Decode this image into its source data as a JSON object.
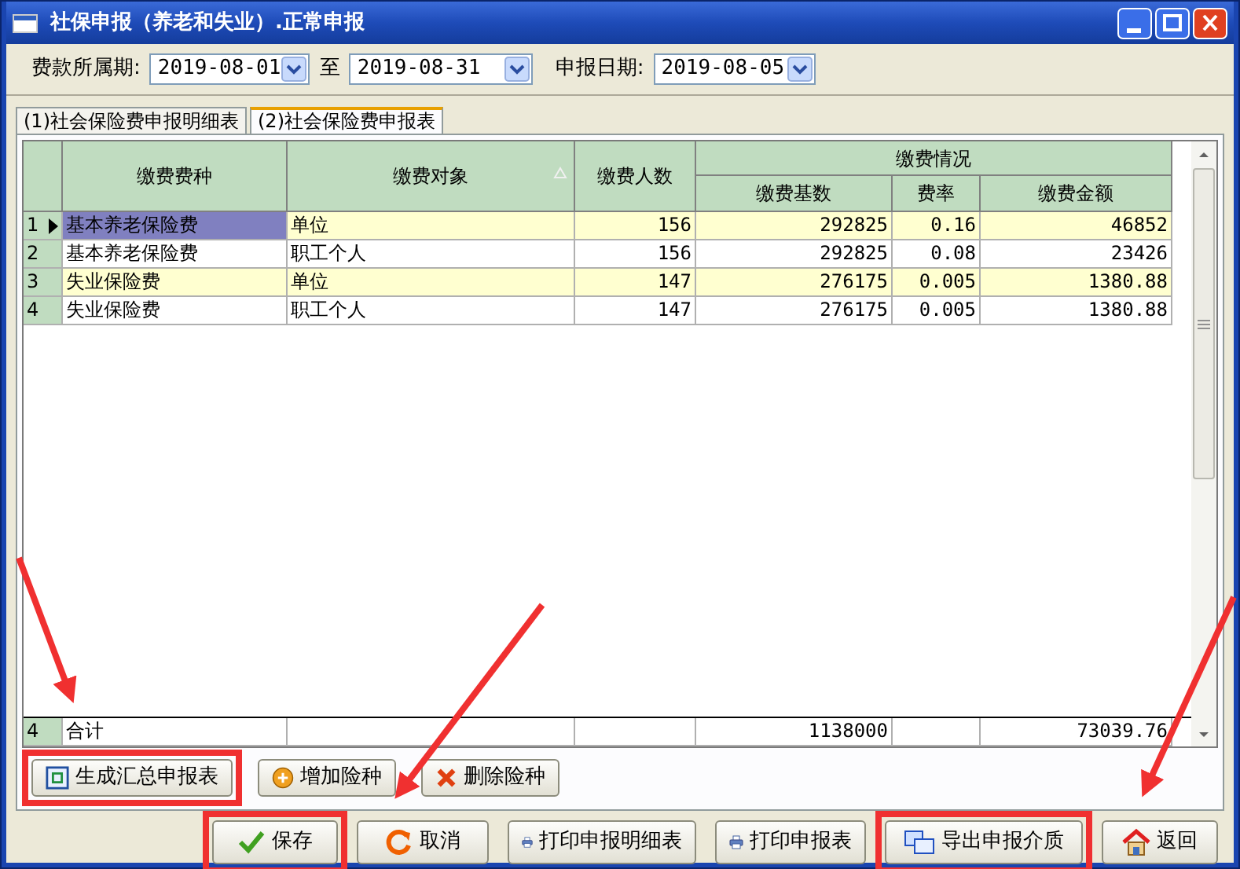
{
  "window": {
    "title": "社保申报（养老和失业）.正常申报"
  },
  "filters": {
    "period_label": "费款所属期:",
    "period_from": "2019-08-01",
    "to_label": "至",
    "period_to": "2019-08-31",
    "declare_label": "申报日期:",
    "declare_date": "2019-08-05"
  },
  "tabs": [
    {
      "label": "(1)社会保险费申报明细表",
      "selected": false
    },
    {
      "label": "(2)社会保险费申报表",
      "selected": true
    }
  ],
  "table": {
    "group_header": "缴费情况",
    "columns": [
      {
        "label": "缴费费种",
        "sorted": false
      },
      {
        "label": "缴费对象",
        "sorted": true
      },
      {
        "label": "缴费人数",
        "sorted": false
      },
      {
        "label": "缴费基数",
        "sorted": false
      },
      {
        "label": "费率",
        "sorted": false
      },
      {
        "label": "缴费金额",
        "sorted": false
      }
    ],
    "rows": [
      {
        "number": "1",
        "current": true,
        "selected": true,
        "cells": [
          "基本养老保险费",
          "单位",
          "156",
          "292825",
          "0.16",
          "46852"
        ]
      },
      {
        "number": "2",
        "current": false,
        "selected": false,
        "cells": [
          "基本养老保险费",
          "职工个人",
          "156",
          "292825",
          "0.08",
          "23426"
        ]
      },
      {
        "number": "3",
        "current": false,
        "selected": false,
        "cells": [
          "失业保险费",
          "单位",
          "147",
          "276175",
          "0.005",
          "1380.88"
        ]
      },
      {
        "number": "4",
        "current": false,
        "selected": false,
        "cells": [
          "失业保险费",
          "职工个人",
          "147",
          "276175",
          "0.005",
          "1380.88"
        ]
      }
    ],
    "footer": {
      "number": "4",
      "label": "合计",
      "base": "1138000",
      "amount": "73039.76"
    }
  },
  "grid_buttons": [
    {
      "label": "生成汇总申报表",
      "kind": "generate",
      "highlighted": true
    },
    {
      "label": "增加险种",
      "kind": "add",
      "highlighted": false
    },
    {
      "label": "删除险种",
      "kind": "delete",
      "highlighted": false
    }
  ],
  "buttons": [
    {
      "label": "保存",
      "kind": "save",
      "highlighted": true
    },
    {
      "label": "取消",
      "kind": "cancel",
      "highlighted": false
    },
    {
      "label": "打印申报明细表",
      "kind": "print",
      "highlighted": false
    },
    {
      "label": "打印申报表",
      "kind": "print",
      "highlighted": false
    },
    {
      "label": "导出申报介质",
      "kind": "export",
      "highlighted": true
    },
    {
      "label": "返回",
      "kind": "home",
      "highlighted": false
    }
  ]
}
